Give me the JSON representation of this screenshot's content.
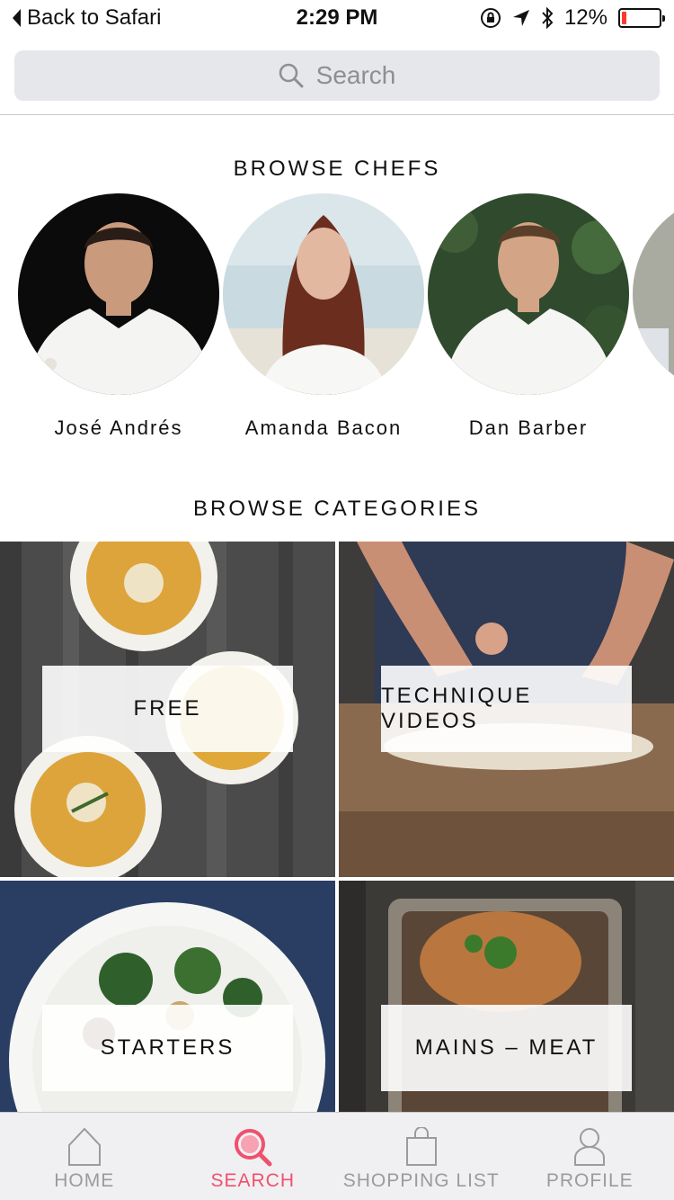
{
  "status_bar": {
    "back_label": "Back to Safari",
    "time": "2:29 PM",
    "battery": "12%",
    "battery_level": 0.12
  },
  "search": {
    "placeholder": "Search"
  },
  "chefs": {
    "title": "BROWSE CHEFS",
    "items": [
      {
        "name": "José Andrés"
      },
      {
        "name": "Amanda Bacon"
      },
      {
        "name": "Dan Barber"
      }
    ]
  },
  "categories": {
    "title": "BROWSE CATEGORIES",
    "items": [
      {
        "label": "FREE"
      },
      {
        "label": "TECHNIQUE VIDEOS"
      },
      {
        "label": "STARTERS"
      },
      {
        "label": "MAINS – MEAT"
      }
    ]
  },
  "tabbar": {
    "tabs": [
      {
        "label": "HOME",
        "icon": "home-icon"
      },
      {
        "label": "SEARCH",
        "icon": "search-icon"
      },
      {
        "label": "SHOPPING LIST",
        "icon": "shopping-bag-icon"
      },
      {
        "label": "PROFILE",
        "icon": "profile-icon"
      }
    ]
  },
  "colors": {
    "accent": "#f0506e",
    "battery_low": "#ff3b30"
  }
}
